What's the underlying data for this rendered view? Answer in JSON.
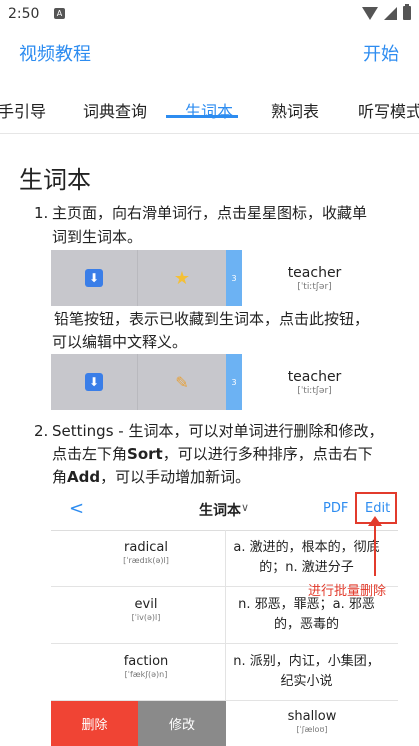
{
  "status": {
    "time": "2:50",
    "app_icon": "A"
  },
  "appbar": {
    "title": "视频教程",
    "start": "开始"
  },
  "tabs": [
    "手引导",
    "词典查询",
    "生词本",
    "熟词表",
    "听写模式"
  ],
  "page": {
    "heading": "生词本",
    "step1_num": "1.",
    "step1_text_line1": "主页面，向右滑单词行，点击星星图标，收藏单",
    "step1_text_line2": "词到生词本。",
    "pencil_text_line1": "铅笔按钮，表示已收藏到生词本，点击此按钮，",
    "pencil_text_line2": "可以编辑中文释义。",
    "step2_num": "2.",
    "step2_line1": "Settings - 生词本，可以对单词进行删除和修改，",
    "step2_line2_a": "点击左下角",
    "step2_line2_b": "Sort",
    "step2_line2_c": "，可以进行多种排序，点击右下",
    "step2_line3_a": "角",
    "step2_line3_b": "Add",
    "step2_line3_c": "，可以手动增加新词。"
  },
  "example_rows": [
    {
      "word": "teacher",
      "phon": "[ˈtiːtʃər]",
      "badge": "3",
      "icon2": "star-icon"
    },
    {
      "word": "teacher",
      "phon": "[ˈtiːtʃər]",
      "badge": "3",
      "icon2": "pencil-icon"
    }
  ],
  "screenshot": {
    "title": "生词本",
    "pdf": "PDF",
    "edit": "Edit",
    "annotation": "进行批量删除",
    "rows": [
      {
        "word": "radical",
        "phon": "[ˈrædɪk(ə)l]",
        "def": "a. 激进的，根本的，彻底的；n. 激进分子"
      },
      {
        "word": "evil",
        "phon": "[ˈiv(ə)l]",
        "def": "n. 邪恶，罪恶；a. 邪恶的，恶毒的"
      },
      {
        "word": "faction",
        "phon": "[ˈfækʃ(ə)n]",
        "def": "n. 派别，内讧，小集团，纪实小说"
      },
      {
        "word": "shallow",
        "phon": "[ˈʃæloʊ]",
        "def": ""
      }
    ],
    "delete_label": "删除",
    "modify_label": "修改"
  }
}
